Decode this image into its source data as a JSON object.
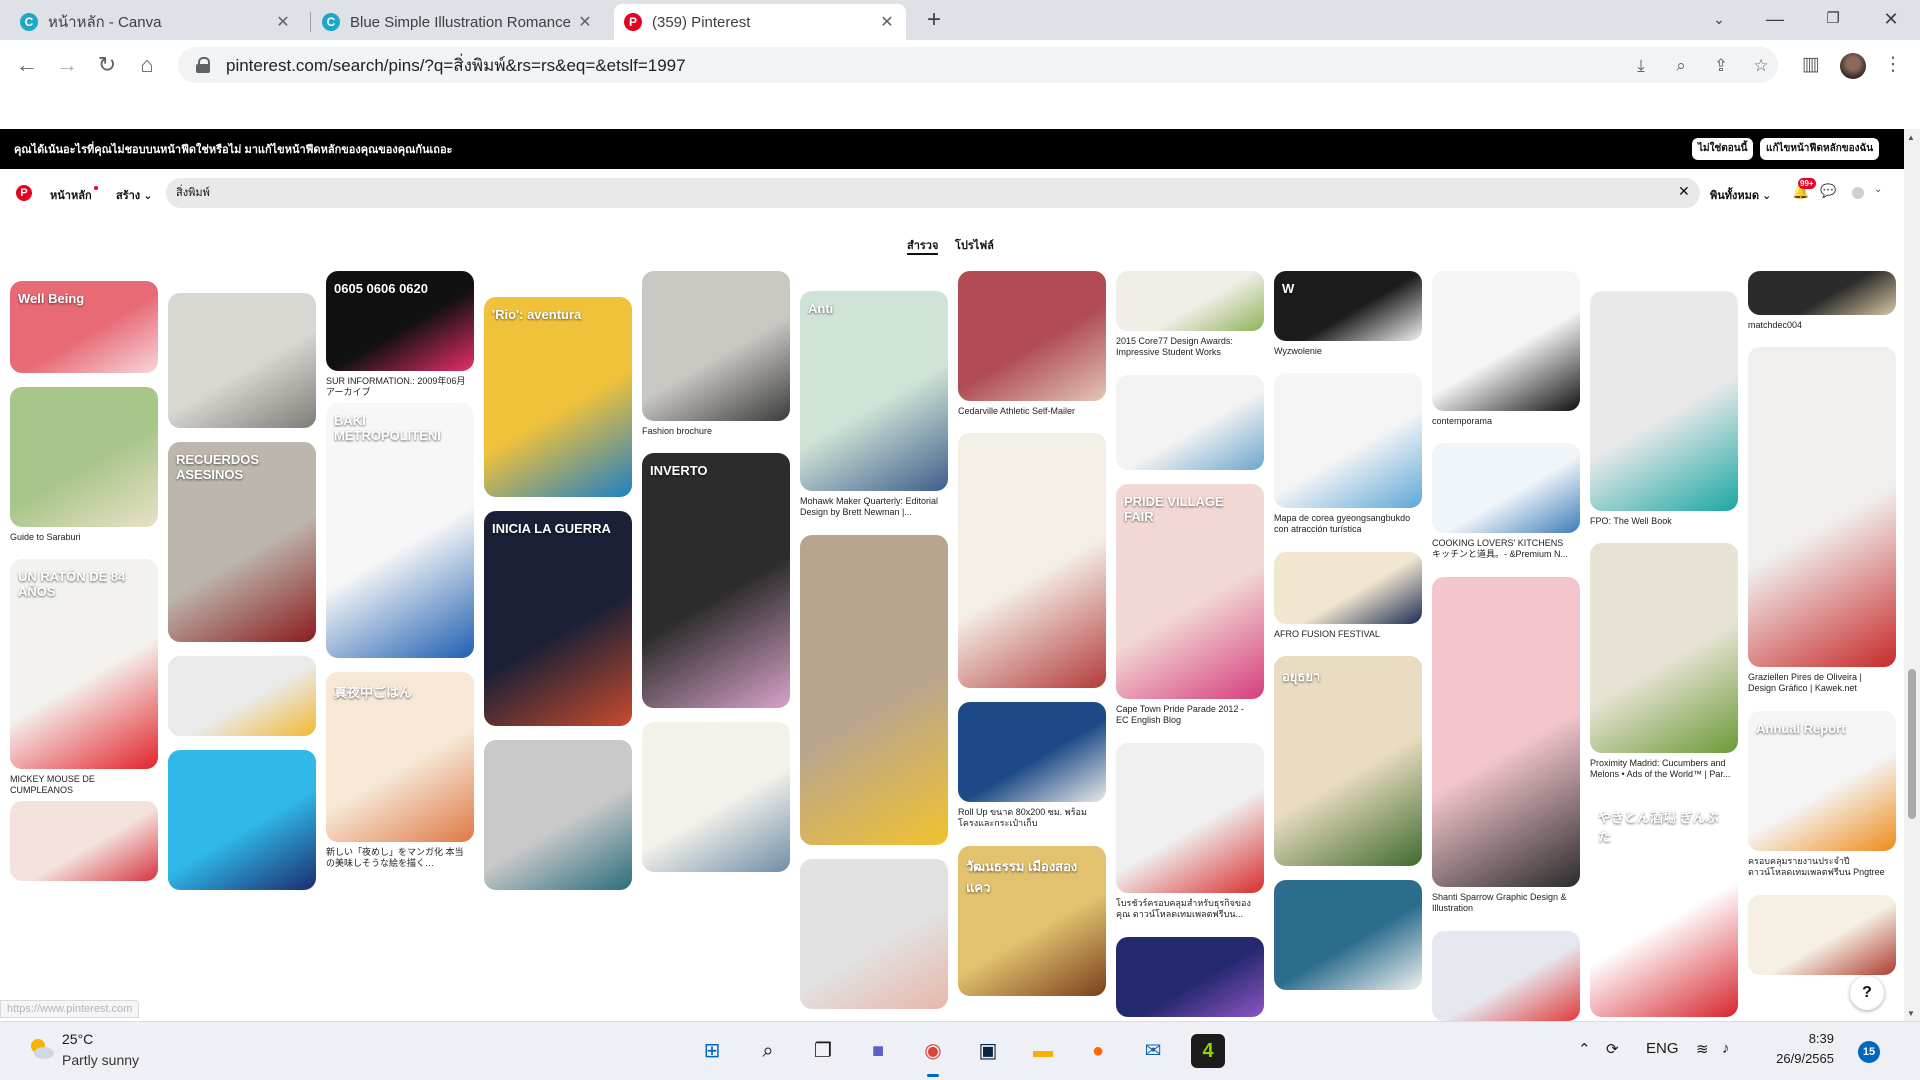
{
  "browser": {
    "tabs": [
      {
        "title": "หน้าหลัก - Canva",
        "icon": "canva-icon",
        "active": false
      },
      {
        "title": "Blue Simple Illustration Romance",
        "icon": "canva-icon",
        "active": false
      },
      {
        "title": "(359) Pinterest",
        "icon": "pinterest-icon",
        "active": true
      }
    ],
    "url": "pinterest.com/search/pins/?q=สิ่งพิมพ์&rs=rs&eq=&etslf=1997"
  },
  "banner": {
    "text": "คุณได้เน้นอะไรที่คุณไม่ชอบบนหน้าฟีดใช่หรือไม่ มาแก้ไขหน้าฟีดหลักของคุณของคุณกันเถอะ",
    "button_no": "ไม่ใช่ตอนนี้",
    "button_fix": "แก้ไขหน้าฟีดหลักของฉัน"
  },
  "pinterest_nav": {
    "home": "หน้าหลัก",
    "create": "สร้าง",
    "search_value": "สิ่งพิมพ์",
    "clear": "✕",
    "filter": "พินทั้งหมด",
    "notif_badge": "99+"
  },
  "subtabs": [
    "สำรวจ",
    "โปรไฟล์"
  ],
  "pins": [
    [
      {
        "h": 92,
        "colors": [
          "#e86a75",
          "#f7d6da"
        ],
        "caption": "",
        "overlay": "Well Being"
      },
      {
        "h": 140,
        "colors": [
          "#a9c68a",
          "#e9e1c8"
        ],
        "caption": "Guide to Saraburi"
      },
      {
        "h": 210,
        "colors": [
          "#f4f2ee",
          "#e2232a"
        ],
        "caption": "MICKEY MOUSE DE CUMPLEANOS",
        "overlay": "UN RATÓN DE 84 AÑOS"
      },
      {
        "h": 80,
        "colors": [
          "#f3e3dc",
          "#d6343f"
        ],
        "caption": ""
      }
    ],
    [
      {
        "h": 135,
        "colors": [
          "#d9d7d2",
          "#7f7c76"
        ],
        "caption": ""
      },
      {
        "h": 200,
        "colors": [
          "#bdb6ad",
          "#8a1c1c"
        ],
        "caption": "",
        "overlay": "RECUERDOS ASESINOS"
      },
      {
        "h": 80,
        "colors": [
          "#eaeaea",
          "#f2b731"
        ],
        "caption": ""
      },
      {
        "h": 140,
        "colors": [
          "#2fb8e8",
          "#1c2c6e"
        ],
        "caption": ""
      }
    ],
    [
      {
        "h": 100,
        "colors": [
          "#111111",
          "#e92e68"
        ],
        "caption": "SUR INFORMATION.: 2009年06月 アーカイブ",
        "overlay": "0605 0606 0620"
      },
      {
        "h": 255,
        "colors": [
          "#f7f7f7",
          "#1f5fb2"
        ],
        "caption": "",
        "overlay": "BAKI METROPOLITENI"
      },
      {
        "h": 170,
        "colors": [
          "#f6e7d6",
          "#e07946"
        ],
        "caption": "新しい「夜めし」をマンガ化 本当の美味しそうな絵を描く…",
        "overlay": "真夜中ごはん"
      }
    ],
    [
      {
        "h": 200,
        "colors": [
          "#f0c23a",
          "#1e7fc4"
        ],
        "caption": "",
        "overlay": "'Rio': aventura"
      },
      {
        "h": 215,
        "colors": [
          "#1b2036",
          "#c84b2e"
        ],
        "caption": "",
        "overlay": "INICIA LA GUERRA"
      },
      {
        "h": 150,
        "colors": [
          "#c9c9c9",
          "#2b6d7d"
        ],
        "caption": ""
      }
    ],
    [
      {
        "h": 150,
        "colors": [
          "#c9c7c2",
          "#3b3b3b"
        ],
        "caption": "Fashion brochure"
      },
      {
        "h": 255,
        "colors": [
          "#2c2c2c",
          "#d8a2c8"
        ],
        "caption": "",
        "overlay": "INVERTO"
      },
      {
        "h": 150,
        "colors": [
          "#f3f1ea",
          "#6e8ea8"
        ],
        "caption": ""
      }
    ],
    [
      {
        "h": 200,
        "colors": [
          "#cfe4d6",
          "#3e5e8c"
        ],
        "caption": "Mohawk Maker Quarterly: Editorial Design by Brett Newman |...",
        "overlay": "Anti"
      },
      {
        "h": 310,
        "colors": [
          "#b9a58e",
          "#f1c230"
        ],
        "caption": ""
      },
      {
        "h": 150,
        "colors": [
          "#e2e2e2",
          "#e6b7a9"
        ],
        "caption": ""
      }
    ],
    [
      {
        "h": 130,
        "colors": [
          "#b04c52",
          "#e2c7b4"
        ],
        "caption": "Cedarville Athletic Self-Mailer"
      },
      {
        "h": 255,
        "colors": [
          "#f4efe6",
          "#b33b3b"
        ],
        "caption": ""
      },
      {
        "h": 100,
        "colors": [
          "#1d4a86",
          "#e9e9e9"
        ],
        "caption": "Roll Up ขนาด 80x200 ซม. พร้อมโครงและกระเป๋าเก็บ"
      },
      {
        "h": 150,
        "colors": [
          "#e3c26f",
          "#7a3f1d"
        ],
        "caption": "",
        "overlay": "วัฒนธรรม เมืองสองแคว"
      }
    ],
    [
      {
        "h": 60,
        "colors": [
          "#f1eee7",
          "#8db35a"
        ],
        "caption": "2015 Core77 Design Awards: Impressive Student Works"
      },
      {
        "h": 95,
        "colors": [
          "#f3f3f3",
          "#6aa6cc"
        ],
        "caption": ""
      },
      {
        "h": 215,
        "colors": [
          "#f2d8d4",
          "#d63d7d"
        ],
        "caption": "Cape Town Pride Parade 2012 - EC English Blog",
        "overlay": "PRIDE VILLAGE FAIR"
      },
      {
        "h": 150,
        "colors": [
          "#f0f0f0",
          "#d82e2e"
        ],
        "caption": "โบรชัวร์ครอบคลุมสำหรับธุรกิจของคุณ ดาวน์โหลดเทมเพลตฟรีบน..."
      },
      {
        "h": 80,
        "colors": [
          "#24286d",
          "#8f55c4"
        ],
        "caption": ""
      }
    ],
    [
      {
        "h": 70,
        "colors": [
          "#1c1c1c",
          "#f2f2f2"
        ],
        "caption": "Wyzwolenie",
        "overlay": "W"
      },
      {
        "h": 135,
        "colors": [
          "#f5f5f5",
          "#5da7d8"
        ],
        "caption": "Mapa de corea gyeongsangbukdo con atracción turística"
      },
      {
        "h": 72,
        "colors": [
          "#f1e6cf",
          "#1d2c55"
        ],
        "caption": "AFRO FUSION FESTIVAL"
      },
      {
        "h": 210,
        "colors": [
          "#e9dcc0",
          "#3f6b2f"
        ],
        "caption": "",
        "overlay": "อยุธยา"
      },
      {
        "h": 110,
        "colors": [
          "#2c6d8d",
          "#f0f0f0"
        ],
        "caption": ""
      }
    ],
    [
      {
        "h": 140,
        "colors": [
          "#f5f5f5",
          "#111111"
        ],
        "caption": "contemporama"
      },
      {
        "h": 90,
        "colors": [
          "#f0f5fa",
          "#3d7cb8"
        ],
        "caption": "COOKING LOVERS' KITCHENS キッチンと道具。- &Premium N..."
      },
      {
        "h": 310,
        "colors": [
          "#f3c6cd",
          "#2b2b2b"
        ],
        "caption": "Shanti Sparrow Graphic Design & Illustration"
      },
      {
        "h": 90,
        "colors": [
          "#e6e8f0",
          "#e03a3a"
        ],
        "caption": ""
      }
    ],
    [
      {
        "h": 220,
        "colors": [
          "#e9e9e9",
          "#1aa7a3"
        ],
        "caption": "FPO: The Well Book"
      },
      {
        "h": 210,
        "colors": [
          "#e7e3d4",
          "#6a9a36"
        ],
        "caption": "Proximity Madrid: Cucumbers and Melons • Ads of the World™ | Par..."
      },
      {
        "h": 220,
        "colors": [
          "#ffffff",
          "#d7262e"
        ],
        "caption": "",
        "overlay": "やきとん酒場 ぎんぶた"
      }
    ],
    [
      {
        "h": 44,
        "colors": [
          "#2b2b2b",
          "#d7c7a3"
        ],
        "caption": "matchdec004"
      },
      {
        "h": 320,
        "colors": [
          "#f0efed",
          "#c72a2a"
        ],
        "caption": "Graziellen Pires de Oliveira | Design Gráfico | Kawek.net"
      },
      {
        "h": 140,
        "colors": [
          "#f5f5f5",
          "#f08a1b"
        ],
        "caption": "ครอบคลุมรายงานประจำปี ดาวน์โหลดเทมเพลตฟรีบน Pngtree",
        "overlay": "Annual Report"
      },
      {
        "h": 80,
        "colors": [
          "#f6f0e4",
          "#ad3a2e"
        ],
        "caption": ""
      }
    ]
  ],
  "status_url": "https://www.pinterest.com",
  "help": "?",
  "taskbar": {
    "weather_temp": "25°C",
    "weather_desc": "Partly sunny",
    "lang": "ENG",
    "time": "8:39",
    "date": "26/9/2565",
    "notif_count": "15",
    "apps": [
      "windows-start-icon",
      "search-icon",
      "task-view-icon",
      "chat-icon",
      "chrome-icon",
      "terminal-icon",
      "file-explorer-icon",
      "firefox-icon",
      "mail-icon",
      "app-icon"
    ]
  }
}
